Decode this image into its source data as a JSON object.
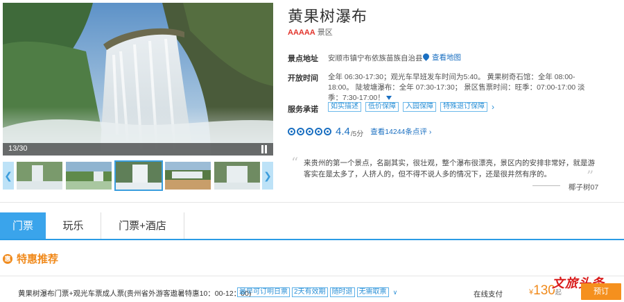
{
  "gallery": {
    "counter": "13/30",
    "thumb_count": 5,
    "active_thumb": 2
  },
  "scenic": {
    "title": "黄果树瀑布",
    "level_stars": "AAAAA",
    "level_suffix": "景区"
  },
  "address": {
    "label": "景点地址",
    "value": "安顺市镇宁布依族苗族自治县",
    "map_link": "查看地图"
  },
  "hours": {
    "label": "开放时间",
    "value": "全年 06:30-17:30；观光车早班发车时间为5:40。 黄果树奇石馆：全年 08:00-18:00。 陡坡塘瀑布：全年 07:30-17:30； 景区售票时间：旺季：07:00-17:00 淡季：7:30-17:00！"
  },
  "promise": {
    "label": "服务承诺",
    "tags": [
      "如实描述",
      "低价保障",
      "入园保障",
      "特殊退订保障"
    ]
  },
  "rating": {
    "score": "4.4",
    "max": "/5分",
    "circles": 5,
    "review_link": "查看14244条点评"
  },
  "review": {
    "text": "来贵州的第一个景点，名副其实，很壮观，整个瀑布很漂亮，景区内的安排非常好，就是游客实在是太多了，人挤人的，但不得不说人多的情况下，还是很井然有序的。",
    "author": "椰子树07"
  },
  "tabs": [
    "门票",
    "玩乐",
    "门票+酒店"
  ],
  "deals": {
    "title": "特惠推荐",
    "icon": "惠",
    "item": {
      "name": "黄果树瀑布门票+观光车票成人票(贵州省外游客遨暑特惠10：00-12：00)",
      "tags": [
        "最早可订明日票",
        "2天有效期",
        "随时退",
        "无需取票"
      ],
      "payment": "在线支付",
      "currency": "¥",
      "price": "130",
      "price_suffix": "起",
      "book_label": "预订"
    }
  },
  "watermark": "文旅头条",
  "colors": {
    "accent_blue": "#3aa4eb",
    "link_blue": "#1a6fc1",
    "orange": "#f08a1c",
    "red": "#e2332b"
  }
}
